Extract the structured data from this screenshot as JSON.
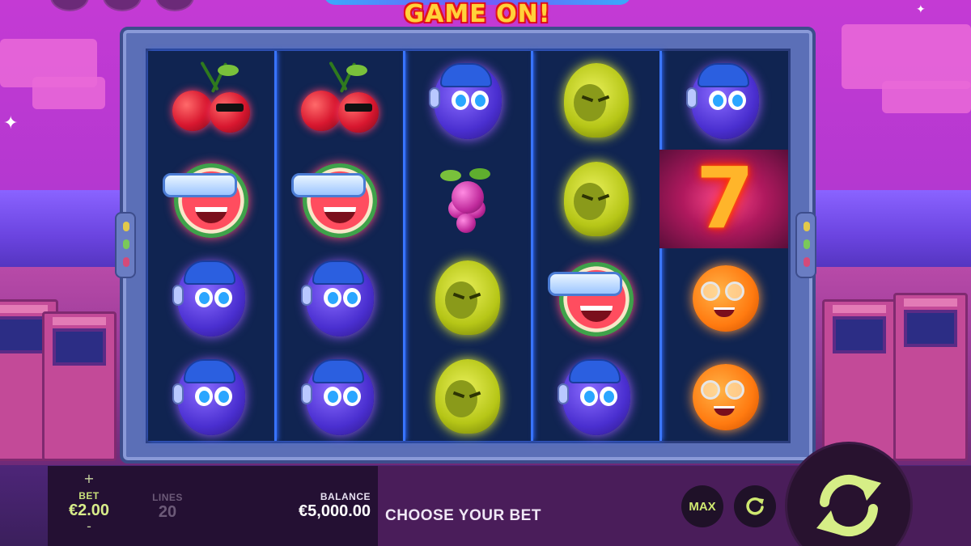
{
  "title": {
    "subtitle": "GAME ON!"
  },
  "reels": [
    [
      "cherry",
      "watermelon",
      "plum",
      "plum"
    ],
    [
      "cherry",
      "watermelon",
      "plum",
      "plum"
    ],
    [
      "plum",
      "grape",
      "lemon",
      "lemon"
    ],
    [
      "lemon",
      "lemon",
      "watermelon",
      "plum"
    ],
    [
      "plum",
      "seven",
      "orange",
      "orange"
    ]
  ],
  "seven_symbol": "7",
  "bottom_bar": {
    "bet_plus": "+",
    "bet_minus": "-",
    "bet_label": "BET",
    "bet_value": "€2.00",
    "lines_label": "LINES",
    "lines_value": "20",
    "balance_label": "BALANCE",
    "balance_value": "€5,000.00",
    "message": "CHOOSE YOUR BET",
    "max_label": "MAX"
  },
  "colors": {
    "accent": "#cfe870",
    "title": "#ffd23a",
    "reel_divider": "#3b77ff"
  },
  "icons": {
    "autoplay": "refresh-icon",
    "spin": "spin-arrows-icon"
  }
}
